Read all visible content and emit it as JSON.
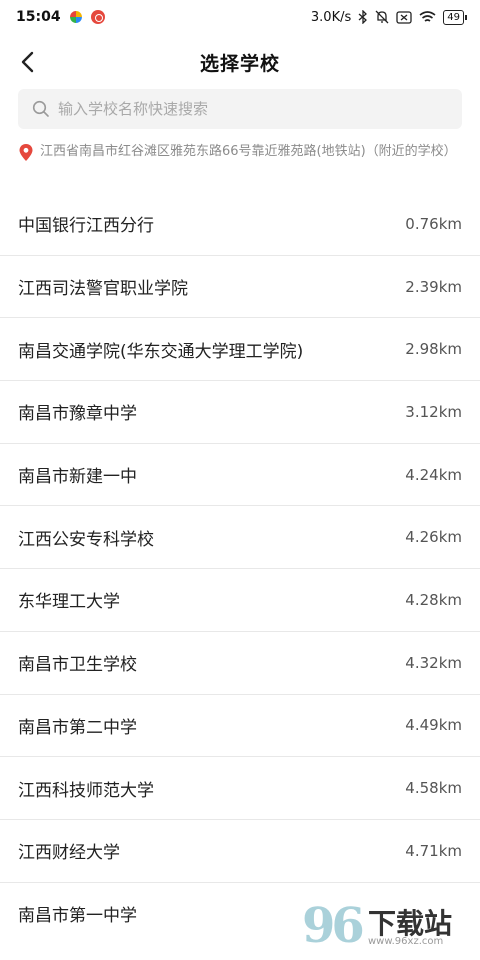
{
  "status_bar": {
    "time": "15:04",
    "network_speed": "3.0K/s",
    "battery_level": "49",
    "icons": [
      "colorful-app-icon",
      "red-app-icon",
      "bluetooth-icon",
      "mute-icon",
      "sim-off-icon",
      "wifi-icon",
      "battery-icon"
    ]
  },
  "header": {
    "title": "选择学校",
    "back_icon": "chevron-left-icon"
  },
  "search": {
    "placeholder": "输入学校名称快速搜索",
    "value": ""
  },
  "location": {
    "text": "江西省南昌市红谷滩区雅苑东路66号靠近雅苑路(地铁站)（附近的学校）",
    "icon": "location-pin-icon",
    "accent_color": "#e5483d"
  },
  "schools": [
    {
      "name": "中国银行江西分行",
      "distance": "0.76km"
    },
    {
      "name": "江西司法警官职业学院",
      "distance": "2.39km"
    },
    {
      "name": "南昌交通学院(华东交通大学理工学院)",
      "distance": "2.98km"
    },
    {
      "name": "南昌市豫章中学",
      "distance": "3.12km"
    },
    {
      "name": "南昌市新建一中",
      "distance": "4.24km"
    },
    {
      "name": "江西公安专科学校",
      "distance": "4.26km"
    },
    {
      "name": "东华理工大学",
      "distance": "4.28km"
    },
    {
      "name": "南昌市卫生学校",
      "distance": "4.32km"
    },
    {
      "name": "南昌市第二中学",
      "distance": "4.49km"
    },
    {
      "name": "江西科技师范大学",
      "distance": "4.58km"
    },
    {
      "name": "江西财经大学",
      "distance": "4.71km"
    },
    {
      "name": "南昌市第一中学",
      "distance": ""
    }
  ],
  "watermark": {
    "number": "96",
    "text": "下载站",
    "url": "www.96xz.com"
  }
}
